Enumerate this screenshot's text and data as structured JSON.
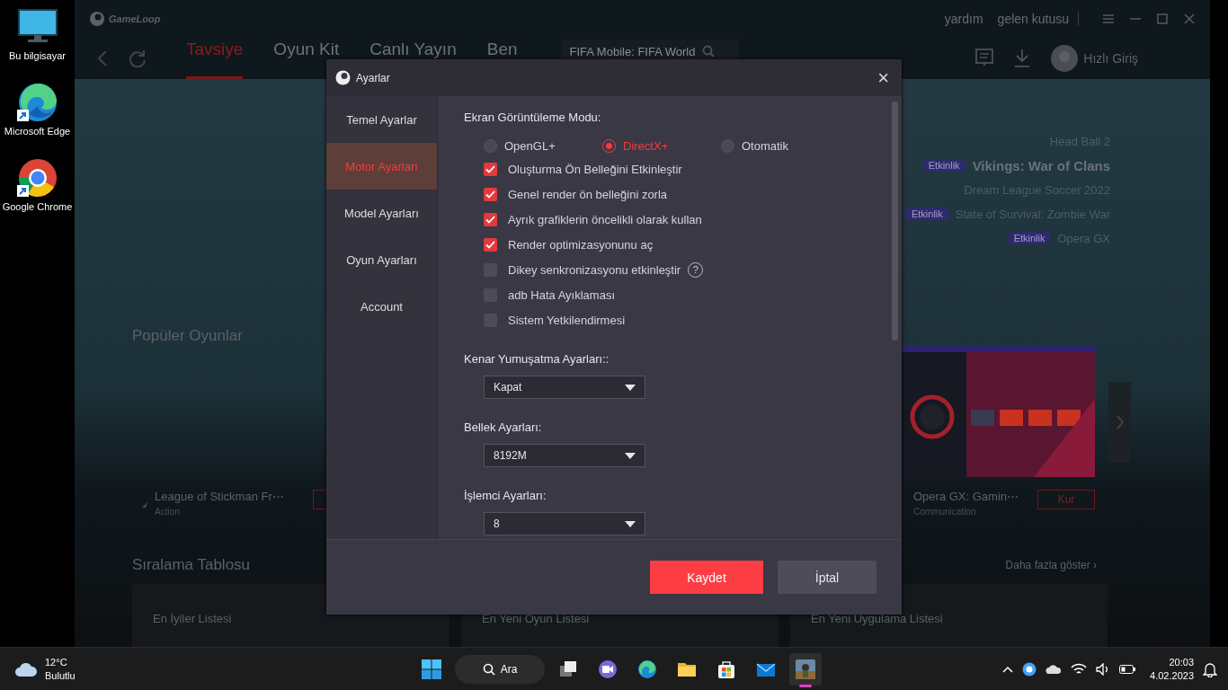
{
  "desktop_icons": [
    {
      "label": "Bu bilgisayar"
    },
    {
      "label": "Microsoft Edge"
    },
    {
      "label": "Google Chrome"
    }
  ],
  "app": {
    "logo": "GameLoop",
    "top_links": [
      "yardım",
      "gelen kutusu"
    ],
    "tabs": [
      {
        "label": "Tavsiye",
        "selected": true
      },
      {
        "label": "Oyun Kit",
        "selected": false
      },
      {
        "label": "Canlı Yayın",
        "selected": false
      },
      {
        "label": "Ben",
        "selected": false
      }
    ],
    "search": {
      "value": "FIFA Mobile: FIFA World"
    },
    "login": "Hızlı Giriş",
    "featured": [
      {
        "title": "Head Ball 2",
        "selected": false
      },
      {
        "tag": "Etkinlik",
        "title": "Vikings: War of Clans",
        "selected": true
      },
      {
        "title": "Dream League Soccer 2022",
        "selected": false
      },
      {
        "tag": "Etkinlik",
        "title": "State of Survival: Zombie War",
        "selected": false
      },
      {
        "tag": "Etkinlik",
        "title": "Opera GX",
        "selected": false
      }
    ],
    "popular": {
      "title": "Popüler Oyunlar",
      "games": [
        {
          "name": "League of Stickman Fr⋯",
          "category": "Action"
        },
        {
          "name": "Opera GX: Gamin⋯",
          "category": "Communication",
          "button": "Kur",
          "kind": "picture"
        }
      ]
    },
    "ranking": {
      "title": "Sıralama Tablosu",
      "more": "Daha fazla göster ›",
      "lists": [
        "En İyiler Listesi",
        "En Yeni Oyun Listesi",
        "En Yeni Uygulama Listesi"
      ]
    }
  },
  "dialog": {
    "title": "Ayarlar",
    "close": "×",
    "sidebar": [
      {
        "label": "Temel Ayarlar",
        "selected": false
      },
      {
        "label": "Motor Ayarları",
        "selected": true
      },
      {
        "label": "Model Ayarları",
        "selected": false
      },
      {
        "label": "Oyun Ayarları",
        "selected": false
      },
      {
        "label": "Account",
        "selected": false
      }
    ],
    "display_mode": {
      "label": "Ekran Görüntüleme Modu:",
      "options": [
        {
          "label": "OpenGL+",
          "selected": false
        },
        {
          "label": "DirectX+",
          "selected": true
        },
        {
          "label": "Otomatik",
          "selected": false
        }
      ]
    },
    "options": [
      {
        "label": "Oluşturma Ön Belleğini Etkinleştir",
        "checked": true
      },
      {
        "label": "Genel render ön belleğini zorla",
        "checked": true
      },
      {
        "label": "Ayrık grafiklerin öncelikli olarak kullan",
        "checked": true
      },
      {
        "label": "Render optimizasyonunu aç",
        "checked": true
      },
      {
        "label": "Dikey senkronizasyonu etkinleştir",
        "checked": false,
        "help": "?"
      },
      {
        "label": "adb Hata Ayıklaması",
        "checked": false
      },
      {
        "label": "Sistem Yetkilendirmesi",
        "checked": false
      }
    ],
    "dropdowns": [
      {
        "label": "Kenar Yumuşatma Ayarları::",
        "value": "Kapat"
      },
      {
        "label": "Bellek Ayarları:",
        "value": "8192M"
      },
      {
        "label": "İşlemci Ayarları:",
        "value": "8"
      }
    ],
    "buttons": [
      {
        "label": "Kaydet",
        "kind": "primary"
      },
      {
        "label": "İptal",
        "kind": "secondary"
      }
    ]
  },
  "taskbar": {
    "weather": {
      "temp": "12°C",
      "condition": "Bulutlu"
    },
    "search": "Ara",
    "time": "20:03",
    "date": "4.02.2023"
  }
}
